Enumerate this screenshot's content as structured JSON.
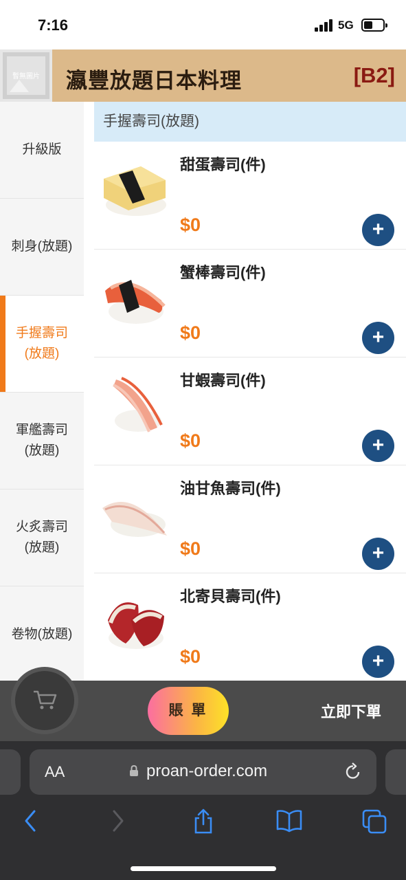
{
  "status_bar": {
    "time": "7:16",
    "network": "5G"
  },
  "header": {
    "logo_text": "暫無圖片",
    "restaurant_name": "瀛豐放題日本料理",
    "table_code": "[B2]"
  },
  "sidebar": {
    "items": [
      {
        "lines": [
          "升級版"
        ]
      },
      {
        "lines": [
          "刺身(放題)"
        ]
      },
      {
        "lines": [
          "手握壽司",
          "(放題)"
        ],
        "active": true
      },
      {
        "lines": [
          "軍艦壽司",
          "(放題)"
        ]
      },
      {
        "lines": [
          "火炙壽司",
          "(放題)"
        ]
      },
      {
        "lines": [
          "卷物(放題)"
        ]
      }
    ]
  },
  "section": {
    "title": "手握壽司(放題)"
  },
  "menu_items": [
    {
      "name": "甜蛋壽司(件)",
      "price": "$0",
      "add_label": "+",
      "icon": "tamago-sushi-image"
    },
    {
      "name": "蟹棒壽司(件)",
      "price": "$0",
      "add_label": "+",
      "icon": "crab-stick-sushi-image"
    },
    {
      "name": "甘蝦壽司(件)",
      "price": "$0",
      "add_label": "+",
      "icon": "sweet-shrimp-sushi-image"
    },
    {
      "name": "油甘魚壽司(件)",
      "price": "$0",
      "add_label": "+",
      "icon": "yellowtail-sushi-image"
    },
    {
      "name": "北寄貝壽司(件)",
      "price": "$0",
      "add_label": "+",
      "icon": "surf-clam-sushi-image"
    }
  ],
  "order_bar": {
    "bill_label": "賬 單",
    "submit_label": "立即下單",
    "cart_icon": "cart-icon"
  },
  "browser": {
    "aa_label": "AA",
    "url": "proan-order.com"
  },
  "colors": {
    "accent": "#f07a1a",
    "header_bg": "#dcb98a",
    "table_code": "#8a1a12",
    "add_button": "#1e4f82",
    "section_bg": "#d7ebf8"
  }
}
